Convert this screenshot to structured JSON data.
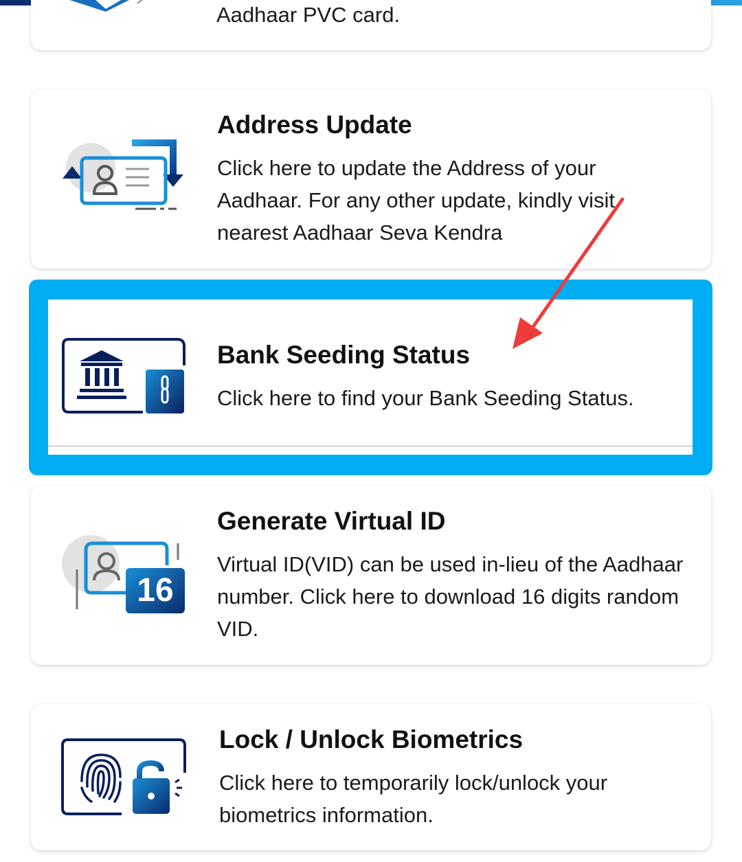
{
  "cards": [
    {
      "id": "pvc",
      "icon": "aadhaar-pvc-card-icon",
      "title": "",
      "description": "Aadhaar PVC card."
    },
    {
      "id": "address",
      "icon": "address-update-icon",
      "title": "Address Update",
      "description": "Click here to update the Address of your Aadhaar. For any other update, kindly visit nearest Aadhaar Seva Kendra"
    },
    {
      "id": "bank",
      "icon": "bank-seeding-icon",
      "title": "Bank Seeding Status",
      "description": "Click here to find your Bank Seeding Status."
    },
    {
      "id": "vid",
      "icon": "virtual-id-icon",
      "title": "Generate Virtual ID",
      "description": "Virtual ID(VID) can be used in-lieu of the Aadhaar number. Click here to download 16 digits random VID.",
      "icon_badge": "16"
    },
    {
      "id": "biometrics",
      "icon": "biometric-lock-icon",
      "title": "Lock / Unlock Biometrics",
      "description": "Click here to temporarily lock/unlock your biometrics information."
    }
  ],
  "colors": {
    "highlight": "#00adf2",
    "annotation_arrow": "#ee3b3b",
    "icon_dark": "#0a1f5c",
    "icon_blue": "#1a8fd6"
  }
}
